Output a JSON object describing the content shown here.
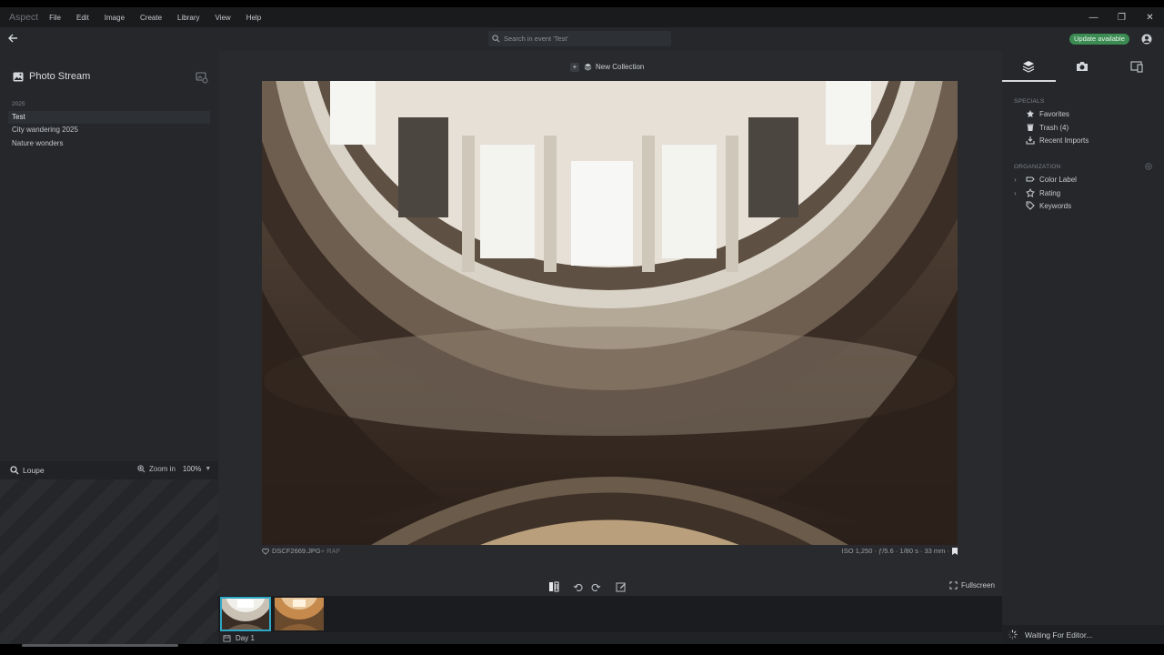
{
  "app": {
    "name": "Aspect"
  },
  "menu": [
    "File",
    "Edit",
    "Image",
    "Create",
    "Library",
    "View",
    "Help"
  ],
  "search": {
    "placeholder": "Search in event 'Test'"
  },
  "update_badge": "Update available",
  "left_panel": {
    "title": "Photo Stream",
    "year": "2025",
    "events": [
      "Test",
      "City wandering 2025",
      "Nature wonders"
    ],
    "selected_event": "Test"
  },
  "loupe": {
    "label": "Loupe",
    "zoom_label": "Zoom in",
    "zoom_value": "100%"
  },
  "viewer": {
    "new_collection": "New Collection",
    "file_name": "DSCF2669.JPG",
    "file_suffix": "+ RAF",
    "exif": "ISO 1,250  ·  ƒ/5.6  ·  1/80 s  ·  33 mm  ·",
    "fullscreen": "Fullscreen"
  },
  "filmstrip": {
    "day_label": "Day 1",
    "thumbnails": [
      "dome-interior-1",
      "dome-interior-2"
    ]
  },
  "right_panel": {
    "specials_label": "SPECIALS",
    "specials": [
      "Favorites",
      "Trash (4)",
      "Recent Imports"
    ],
    "organization_label": "ORGANIZATION",
    "organization": [
      "Color Label",
      "Rating",
      "Keywords"
    ]
  },
  "status": {
    "text": "Waiting For Editor..."
  },
  "colors": {
    "accent": "#2ea7c6",
    "update_green": "#3c8b53",
    "panel": "#25272a",
    "viewer_bg": "#282a2d"
  }
}
